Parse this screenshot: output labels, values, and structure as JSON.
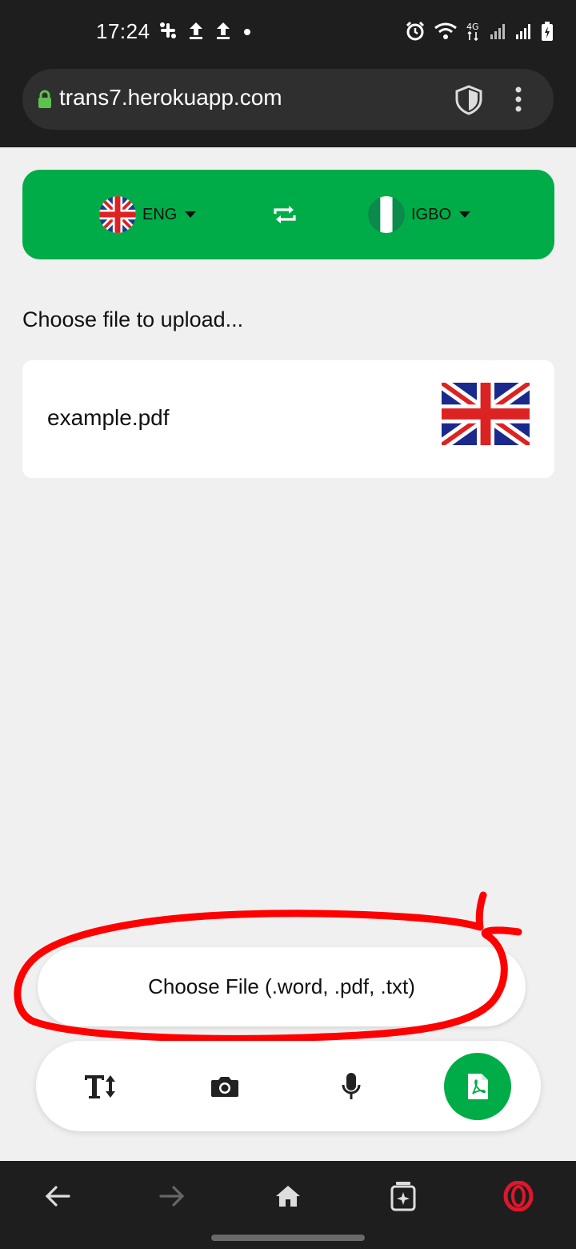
{
  "status": {
    "time": "17:24",
    "network": "4G"
  },
  "browser": {
    "url": "trans7.herokuapp.com"
  },
  "language": {
    "source": "ENG",
    "target": "IGBO"
  },
  "upload": {
    "label": "Choose file to upload...",
    "file_name": "example.pdf",
    "choose_button": "Choose File (.word, .pdf, .txt)"
  },
  "colors": {
    "accent": "#00ac47",
    "annotation": "#ff0000"
  },
  "icons": {
    "tools": [
      "text-size-icon",
      "camera-icon",
      "microphone-icon",
      "pdf-icon"
    ],
    "nav": [
      "back-arrow-icon",
      "forward-arrow-icon",
      "home-icon",
      "tabs-icon",
      "opera-icon"
    ]
  }
}
